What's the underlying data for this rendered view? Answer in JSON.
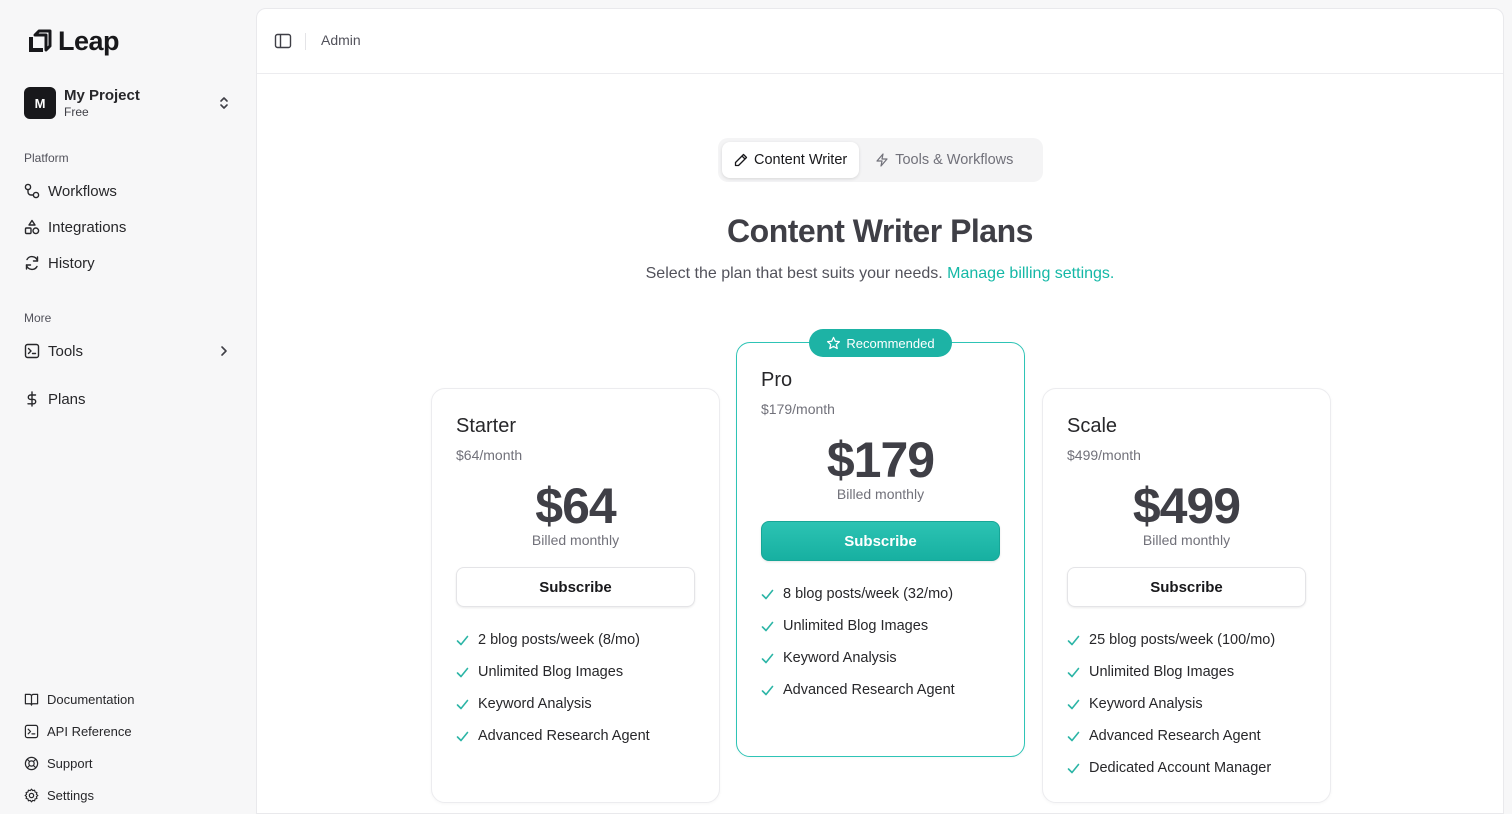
{
  "brand": {
    "name": "Leap"
  },
  "project": {
    "avatar": "M",
    "name": "My Project",
    "plan": "Free"
  },
  "sidebar": {
    "platform_label": "Platform",
    "platform_items": [
      {
        "label": "Workflows",
        "icon": "workflow-icon"
      },
      {
        "label": "Integrations",
        "icon": "shapes-icon"
      },
      {
        "label": "History",
        "icon": "refresh-icon"
      }
    ],
    "more_label": "More",
    "more_items": [
      {
        "label": "Tools",
        "icon": "terminal-icon"
      },
      {
        "label": "Plans",
        "icon": "dollar-icon"
      }
    ],
    "footer_items": [
      {
        "label": "Documentation",
        "icon": "book-icon"
      },
      {
        "label": "API Reference",
        "icon": "terminal-icon"
      },
      {
        "label": "Support",
        "icon": "lifebuoy-icon"
      },
      {
        "label": "Settings",
        "icon": "gear-icon"
      }
    ]
  },
  "header": {
    "breadcrumb": "Admin"
  },
  "tabs": [
    {
      "label": "Content Writer",
      "icon": "pencil-icon",
      "active": true
    },
    {
      "label": "Tools & Workflows",
      "icon": "lightning-icon",
      "active": false
    }
  ],
  "page": {
    "title": "Content Writer Plans",
    "subtitle": "Select the plan that best suits your needs.",
    "billing_link": "Manage billing settings."
  },
  "plans": [
    {
      "name": "Starter",
      "period": "$64/month",
      "price": "$64",
      "billed": "Billed monthly",
      "button": "Subscribe",
      "features": [
        "2 blog posts/week (8/mo)",
        "Unlimited Blog Images",
        "Keyword Analysis",
        "Advanced Research Agent"
      ]
    },
    {
      "name": "Pro",
      "badge": "Recommended",
      "period": "$179/month",
      "price": "$179",
      "billed": "Billed monthly",
      "button": "Subscribe",
      "features": [
        "8 blog posts/week (32/mo)",
        "Unlimited Blog Images",
        "Keyword Analysis",
        "Advanced Research Agent"
      ]
    },
    {
      "name": "Scale",
      "period": "$499/month",
      "price": "$499",
      "billed": "Billed monthly",
      "button": "Subscribe",
      "features": [
        "25 blog posts/week (100/mo)",
        "Unlimited Blog Images",
        "Keyword Analysis",
        "Advanced Research Agent",
        "Dedicated Account Manager"
      ]
    }
  ],
  "colors": {
    "accent": "#1db3a5",
    "link": "#14b8a6",
    "check": "#2cb5a6"
  }
}
